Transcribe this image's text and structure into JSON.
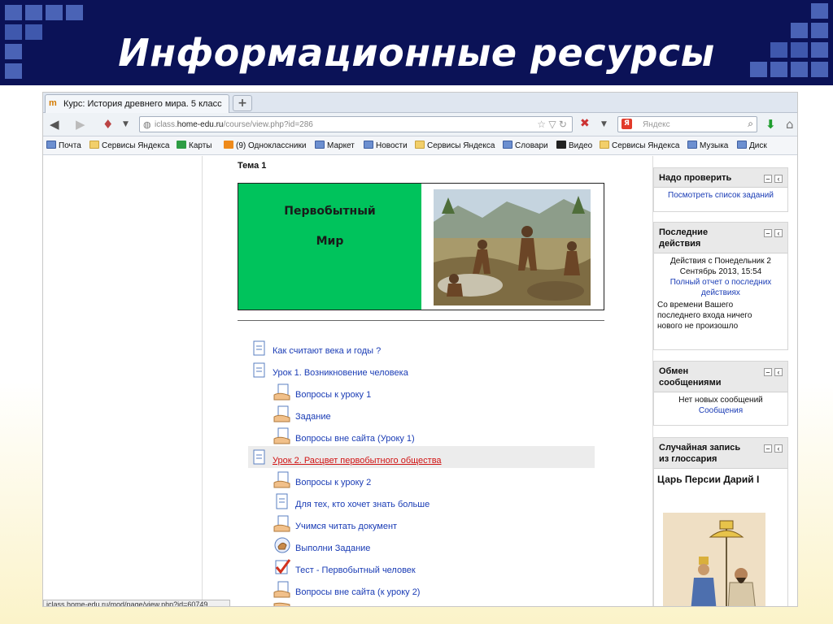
{
  "slide": {
    "title": "Информационные ресурсы",
    "colors": {
      "header": "#0b1257",
      "accent": "#4a63b6"
    }
  },
  "browser": {
    "tab_title": "Курс: История древнего мира. 5 класс",
    "new_tab_label": "+",
    "url_domain": "iclass.home-edu.ru",
    "url_prefix": "iclass.",
    "url_host": "home-edu.ru",
    "url_path": "/course/view.php?id=286",
    "search_placeholder": "Яндекс",
    "search_engine_badge": "Я",
    "bookmarks": [
      {
        "label": "Почта",
        "icon": "mail-icon"
      },
      {
        "label": "Сервисы Яндекса",
        "icon": "folder-icon"
      },
      {
        "label": "Карты",
        "icon": "map-icon"
      },
      {
        "label": "(9) Одноклассники",
        "icon": "odnoklassniki-icon"
      },
      {
        "label": "Маркет",
        "icon": "page-icon"
      },
      {
        "label": "Новости",
        "icon": "page-icon"
      },
      {
        "label": "Сервисы Яндекса",
        "icon": "folder-icon"
      },
      {
        "label": "Словари",
        "icon": "page-icon"
      },
      {
        "label": "Видео",
        "icon": "play-icon"
      },
      {
        "label": "Сервисы Яндекса",
        "icon": "folder-icon"
      },
      {
        "label": "Музыка",
        "icon": "play-icon"
      },
      {
        "label": "Диск",
        "icon": "disk-icon"
      }
    ],
    "status_url": "iclass.home-edu.ru/mod/page/view.php?id=60749"
  },
  "course": {
    "topic": "Тема 1",
    "banner": {
      "line1": "Первобытный",
      "line2": "Мир",
      "color": "#00c35c"
    },
    "resources": [
      {
        "label": "Как считают века и годы ?",
        "icon": "page-icon",
        "indent": false,
        "highlight": false
      },
      {
        "label": "Урок 1. Возникновение человека",
        "icon": "page-icon",
        "indent": false,
        "highlight": false
      },
      {
        "label": "Вопросы к уроку 1",
        "icon": "forum-icon",
        "indent": true,
        "highlight": false
      },
      {
        "label": "Задание",
        "icon": "forum-icon",
        "indent": true,
        "highlight": false
      },
      {
        "label": "Вопросы вне сайта (Уроку 1)",
        "icon": "forum-icon",
        "indent": true,
        "highlight": false
      },
      {
        "label": "Урок 2. Расцвет первобытного общества",
        "icon": "page-icon",
        "indent": false,
        "highlight": true
      },
      {
        "label": "Вопросы к уроку 2",
        "icon": "forum-icon",
        "indent": true,
        "highlight": false
      },
      {
        "label": "Для тех, кто хочет знать больше",
        "icon": "page-icon",
        "indent": true,
        "highlight": false
      },
      {
        "label": "Учимся читать документ",
        "icon": "forum-icon",
        "indent": true,
        "highlight": false
      },
      {
        "label": "Выполни Задание",
        "icon": "assignment-icon",
        "indent": true,
        "highlight": false
      },
      {
        "label": "Тест - Первобытный человек",
        "icon": "quiz-icon",
        "indent": true,
        "highlight": false
      },
      {
        "label": "Вопросы вне сайта (к уроку 2)",
        "icon": "forum-icon",
        "indent": true,
        "highlight": false
      }
    ]
  },
  "blocks": {
    "check": {
      "title": "Надо проверить",
      "link": "Посмотреть список заданий"
    },
    "recent": {
      "title_line1": "Последние",
      "title_line2": "действия",
      "since_line1": "Действия с Понедельник 2",
      "since_line2": "Сентябрь 2013, 15:54",
      "report_line1": "Полный отчет о последних",
      "report_line2": "действиях",
      "note_line1": "Со времени Вашего",
      "note_line2": "последнего входа ничего",
      "note_line3": "нового не произошло"
    },
    "messages": {
      "title_line1": "Обмен",
      "title_line2": "сообщениями",
      "text": "Нет новых сообщений",
      "link": "Сообщения"
    },
    "glossary": {
      "title_line1": "Случайная запись",
      "title_line2": "из глоссария",
      "entry": "Царь Персии Дарий I"
    }
  }
}
